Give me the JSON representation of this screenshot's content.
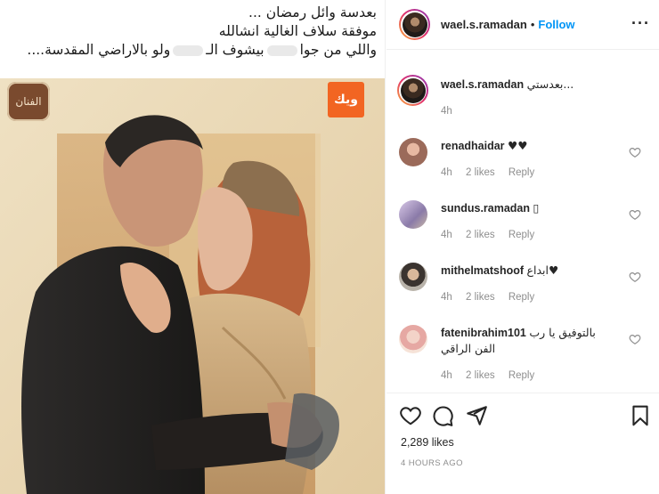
{
  "caption_overlay": {
    "line1": "بعدسة وائل رمضان ...",
    "line2": "موفقة سلاف الغالية انشالله",
    "line3a": "واللي من جوا",
    "line3b": "بيشوف الـ",
    "line3c": "ولو بالاراضي المقدسة...."
  },
  "poster": {
    "badge_left": "الفنان",
    "badge_right": "ويك",
    "colors": {
      "background": "#e9d6b2",
      "frame": "#c8a173"
    }
  },
  "header": {
    "username": "wael.s.ramadan",
    "separator": "•",
    "follow": "Follow",
    "more": "···"
  },
  "comments": [
    {
      "username": "wael.s.ramadan",
      "text": "بعدستي...",
      "time": "4h",
      "likes": "",
      "reply": "",
      "avatar_icon": "profile-avatar"
    },
    {
      "username": "renadhaidar",
      "text": "♥♥",
      "time": "4h",
      "likes": "2 likes",
      "reply": "Reply",
      "avatar_icon": "user-avatar"
    },
    {
      "username": "sundus.ramadan",
      "text": "▯",
      "time": "4h",
      "likes": "2 likes",
      "reply": "Reply",
      "avatar_icon": "user-avatar"
    },
    {
      "username": "mithelmatshoof",
      "text": "ابداع♥",
      "time": "4h",
      "likes": "2 likes",
      "reply": "Reply",
      "avatar_icon": "user-avatar"
    },
    {
      "username": "fatenibrahim101",
      "text": "بالتوفيق يا رب الفن الراقي",
      "time": "4h",
      "likes": "2 likes",
      "reply": "Reply",
      "avatar_icon": "user-avatar"
    }
  ],
  "actions": {
    "likes": "2,289 likes",
    "posted": "4 HOURS AGO",
    "icons": [
      "heart-icon",
      "comment-icon",
      "share-icon",
      "bookmark-icon"
    ]
  },
  "colors": {
    "link": "#0095f6",
    "muted": "#8e8e8e",
    "text": "#262626"
  }
}
